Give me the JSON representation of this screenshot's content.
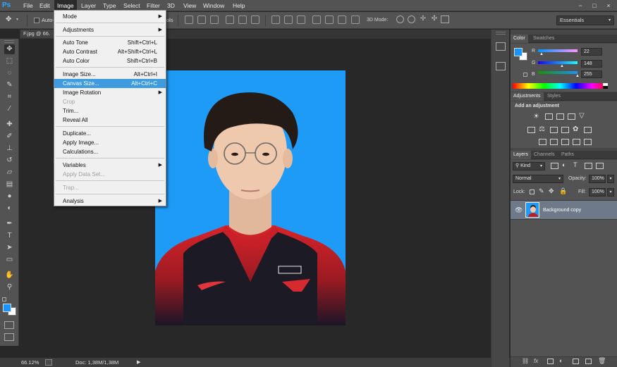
{
  "app": {
    "logo": "Ps"
  },
  "menubar": [
    "File",
    "Edit",
    "Image",
    "Layer",
    "Type",
    "Select",
    "Filter",
    "3D",
    "View",
    "Window",
    "Help"
  ],
  "window_controls": [
    "−",
    "□",
    "×"
  ],
  "options_bar": {
    "auto_label": "Auto-",
    "ols_fragment": "ols",
    "mode_3d": "3D Mode:",
    "workspace": "Essentials"
  },
  "document_tab": "F.jpg @ 66.",
  "status": {
    "zoom": "66.12%",
    "doc": "Doc: 1,38M/1,38M"
  },
  "image_menu": {
    "items": [
      {
        "label": "Mode",
        "submenu": true
      },
      {
        "label": "Adjustments",
        "submenu": true
      },
      {
        "label": "Auto Tone",
        "shortcut": "Shift+Ctrl+L"
      },
      {
        "label": "Auto Contrast",
        "shortcut": "Alt+Shift+Ctrl+L"
      },
      {
        "label": "Auto Color",
        "shortcut": "Shift+Ctrl+B"
      },
      {
        "label": "Image Size...",
        "shortcut": "Alt+Ctrl+I"
      },
      {
        "label": "Canvas Size...",
        "shortcut": "Alt+Ctrl+C",
        "highlighted": true
      },
      {
        "label": "Image Rotation",
        "submenu": true
      },
      {
        "label": "Crop",
        "disabled": true
      },
      {
        "label": "Trim..."
      },
      {
        "label": "Reveal All"
      },
      {
        "label": "Duplicate..."
      },
      {
        "label": "Apply Image..."
      },
      {
        "label": "Calculations..."
      },
      {
        "label": "Variables",
        "submenu": true
      },
      {
        "label": "Apply Data Set...",
        "disabled": true
      },
      {
        "label": "Trap...",
        "disabled": true
      },
      {
        "label": "Analysis",
        "submenu": true
      }
    ]
  },
  "color_panel": {
    "tabs": [
      "Color",
      "Swatches"
    ],
    "channels": [
      {
        "label": "R",
        "value": "22",
        "fill": 0.086
      },
      {
        "label": "G",
        "value": "148",
        "fill": 0.58
      },
      {
        "label": "B",
        "value": "255",
        "fill": 1.0
      }
    ],
    "foreground": "#1694ff"
  },
  "adjustments_panel": {
    "tabs": [
      "Adjustments",
      "Styles"
    ],
    "heading": "Add an adjustment"
  },
  "layers_panel": {
    "tabs": [
      "Layers",
      "Channels",
      "Paths"
    ],
    "kind": "Kind",
    "blend_mode": "Normal",
    "opacity_label": "Opacity:",
    "opacity": "100%",
    "lock_label": "Lock:",
    "fill_label": "Fill:",
    "fill": "100%",
    "layer_name": "Background copy"
  },
  "colors": {
    "accent": "#3f9be0",
    "canvas_bg": "#1e9bf7"
  }
}
